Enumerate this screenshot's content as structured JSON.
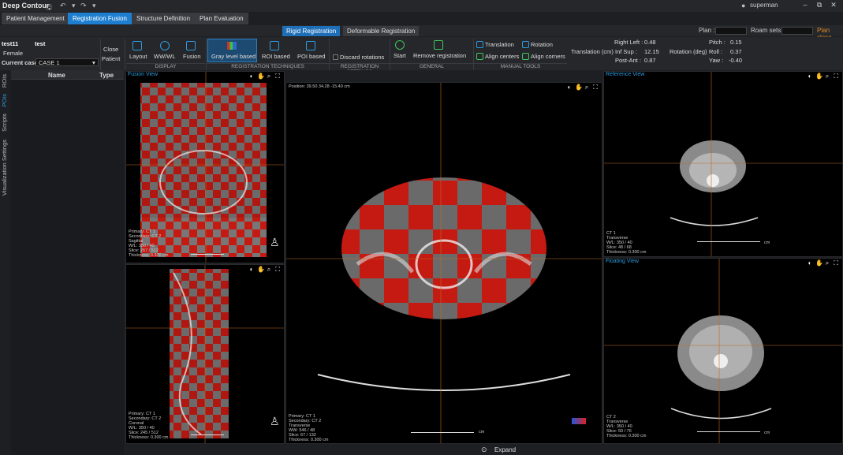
{
  "app": {
    "title": "Deep Contour",
    "user": "superman"
  },
  "nav": {
    "tabs": [
      "Patient Management",
      "Registration Fusion",
      "Structure Definition",
      "Plan Evaluation"
    ],
    "active": 1
  },
  "subtabs": {
    "items": [
      "Rigid Registration",
      "Deformable Registration"
    ],
    "active": 0,
    "plan_label": "Plan :",
    "roam_label": "Roam sets :",
    "plan_close": "Plan close"
  },
  "patient": {
    "id": "test11",
    "name": "test",
    "sex": "Female",
    "current_case_label": "Current case :",
    "case": "CASE 1",
    "close_label": "Close",
    "patient_label": "Patient"
  },
  "ribbon": {
    "display": {
      "group": "DISPLAY",
      "items": [
        "Layout",
        "WW/WL",
        "Fusion"
      ]
    },
    "techniques": {
      "group": "REGISTRATION TECHNIQUES",
      "items": [
        "Gray level based",
        "ROI based",
        "POI based"
      ]
    },
    "settings": {
      "group": "REGISTRATION SETTINGS",
      "discard": "Discard rotations"
    },
    "general": {
      "group": "GENERAL",
      "items": [
        "Start",
        "Remove registration"
      ]
    },
    "manual": {
      "group": "MANUAL TOOLS",
      "items": [
        "Translation",
        "Rotation",
        "Align centers",
        "Align corners"
      ]
    },
    "translation": {
      "title": "Translation (cm)",
      "rl_label": "Right Left :",
      "rl": "0.48",
      "is_label": "Inf Sup :",
      "is": "12.15",
      "pa_label": "Post-Ant :",
      "pa": "0.87"
    },
    "rotation": {
      "title": "Rotation (deg)",
      "pitch_label": "Pitch :",
      "pitch": "0.15",
      "roll_label": "Roll :",
      "roll": "0.37",
      "yaw_label": "Yaw :",
      "yaw": "-0.40"
    }
  },
  "rail": [
    "ROIs",
    "POIs",
    "Scripts",
    "Visualization Settings"
  ],
  "roi_table": {
    "columns": [
      "Name",
      "Type"
    ]
  },
  "views": {
    "fusion": "Fusion View",
    "reference": "Reference View",
    "floating": "Floating View",
    "main_pos": "Position: 39.50 34.28 -15.40 cm",
    "main_info": "Primary: CT 1\nSecondary: CT 2\nTransverse\nWW: 546 / 48\nSlice: 67 / 132\nThickness: 0.300 cm",
    "sag_info": "Primary: CT 1\nSecondary: CT 2\nCoronal\nW/L: 350 / 40\nSlice: 245 / 512\nThickness: 0.300 cm",
    "cor_info": "Primary: CT 1\nSecondary: CT 2\nSagittal\nW/L: 350 / 40\nSlice: 267 / 512\nThickness: 0.300 cm",
    "ref_info": "CT 1\nTransverse\nW/L: 350 / 40\nSlice: 48 / 68\nThickness: 0.300 cm",
    "flo_info": "CT 2\nTransverse\nW/L: 350 / 40\nSlice: 50 / 76\nThickness: 0.300 cm",
    "ruler_cm": "cm"
  },
  "expand": "Expand"
}
